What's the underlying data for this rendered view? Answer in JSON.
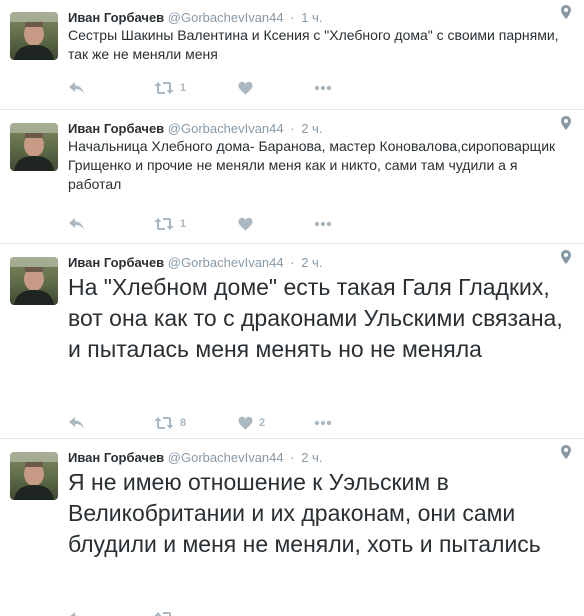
{
  "tweets": [
    {
      "name": "Иван Горбачев",
      "handle": "@GorbachevIvan44",
      "time_sep": "·",
      "time": "1 ч.",
      "text": "Сестры Шакины Валентина и Ксения с \"Хлебного дома\" с своими парнями, так же не меняли меня",
      "retweets": "1",
      "likes": ""
    },
    {
      "name": "Иван Горбачев",
      "handle": "@GorbachevIvan44",
      "time_sep": "·",
      "time": "2 ч.",
      "text": "Начальница Хлебного дома- Баранова, мастер Коновалова,сироповарщик Грищенко и прочие не меняли меня как и никто, сами там чудили а я работал",
      "retweets": "1",
      "likes": ""
    },
    {
      "name": "Иван Горбачев",
      "handle": "@GorbachevIvan44",
      "time_sep": "·",
      "time": "2 ч.",
      "text": "На \"Хлебном доме\"  есть такая Галя Гладких, вот она как то с драконами Ульскими связана, и пыталась меня менять но не меняла",
      "retweets": "8",
      "likes": "2"
    },
    {
      "name": "Иван Горбачев",
      "handle": "@GorbachevIvan44",
      "time_sep": "·",
      "time": "2 ч.",
      "text": "Я не имею отношение к Уэльским в Великобритании и их драконам, они сами блудили и меня не меняли, хоть и пытались",
      "retweets": "",
      "likes": ""
    }
  ],
  "icons": {
    "reply": "reply-icon",
    "retweet": "retweet-icon",
    "like": "heart-icon",
    "more": "more-icon",
    "location": "location-pin-icon"
  },
  "colors": {
    "name": "#292f33",
    "meta": "#8899a6",
    "action_icon": "#aab8c2",
    "divider": "#e1e8ed"
  }
}
